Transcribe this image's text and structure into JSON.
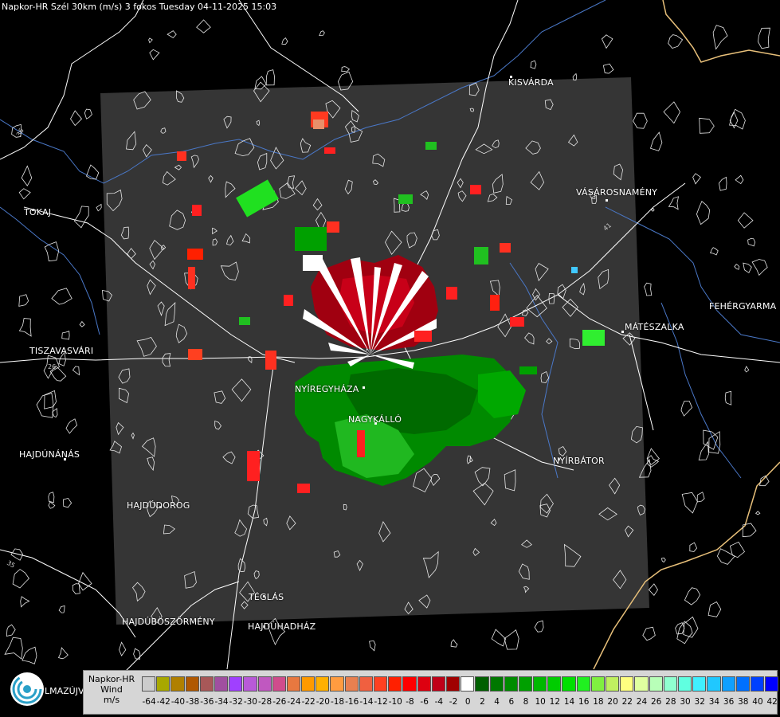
{
  "title": "Napkor-HR Szél 30km (m/s) 3 fokos Tuesday 04-11-2025 15:03",
  "cities": [
    {
      "id": "kisvarda",
      "label": "KISVÁRDA"
    },
    {
      "id": "tokaj",
      "label": "TOKAJ"
    },
    {
      "id": "vasarosnameny",
      "label": "VÁSÁROSNAMÉNY"
    },
    {
      "id": "fehergyarmat",
      "label": "FEHÉRGYARMA"
    },
    {
      "id": "mateszalka",
      "label": "MÁTÉSZALKA"
    },
    {
      "id": "tiszavasvari",
      "label": "TISZAVASVÁRI"
    },
    {
      "id": "nyiregyhaza",
      "label": "NYÍREGYHÁZA"
    },
    {
      "id": "nagykallo",
      "label": "NAGYKÁLLÓ"
    },
    {
      "id": "nyirbator",
      "label": "NYÍRBÁTOR"
    },
    {
      "id": "hajdunanas",
      "label": "HAJDÚNÁNÁS"
    },
    {
      "id": "hajdudorog",
      "label": "HAJDÚDOROG"
    },
    {
      "id": "teglas",
      "label": "TÉGLÁS"
    },
    {
      "id": "hajduboszormeny",
      "label": "HAJDÚBÖSZÖRMÉNY"
    },
    {
      "id": "hajduhadhaz",
      "label": "HAJDÚHADHÁZ"
    }
  ],
  "road_numbers": [
    "36",
    "26",
    "41",
    "35"
  ],
  "logo_text": "LMAZÚJVÁR",
  "legend": {
    "line1": "Napkor-HR",
    "line2": "Wind",
    "line3": "m/s",
    "items": [
      {
        "label": "-64",
        "color": "#cccccc"
      },
      {
        "label": "-42",
        "color": "#a8a800"
      },
      {
        "label": "-40",
        "color": "#b08000"
      },
      {
        "label": "-38",
        "color": "#b05800"
      },
      {
        "label": "-36",
        "color": "#a85858"
      },
      {
        "label": "-34",
        "color": "#a04fa0"
      },
      {
        "label": "-32",
        "color": "#a040ff"
      },
      {
        "label": "-30",
        "color": "#b85ad8"
      },
      {
        "label": "-28",
        "color": "#c058c0"
      },
      {
        "label": "-26",
        "color": "#d04c8c"
      },
      {
        "label": "-24",
        "color": "#e87840"
      },
      {
        "label": "-22",
        "color": "#ff9a00"
      },
      {
        "label": "-20",
        "color": "#ffb000"
      },
      {
        "label": "-18",
        "color": "#ff9c40"
      },
      {
        "label": "-16",
        "color": "#e88050"
      },
      {
        "label": "-14",
        "color": "#f06040"
      },
      {
        "label": "-12",
        "color": "#ff4020"
      },
      {
        "label": "-10",
        "color": "#ff2000"
      },
      {
        "label": "-8",
        "color": "#ff0000"
      },
      {
        "label": "-6",
        "color": "#dd0010"
      },
      {
        "label": "-4",
        "color": "#c00018"
      },
      {
        "label": "-2",
        "color": "#a00000"
      },
      {
        "label": "0",
        "color": "#ffffff"
      },
      {
        "label": "2",
        "color": "#006000"
      },
      {
        "label": "4",
        "color": "#007800"
      },
      {
        "label": "6",
        "color": "#008c00"
      },
      {
        "label": "8",
        "color": "#00a000"
      },
      {
        "label": "10",
        "color": "#00b800"
      },
      {
        "label": "12",
        "color": "#00cc00"
      },
      {
        "label": "14",
        "color": "#00e000"
      },
      {
        "label": "16",
        "color": "#20f020"
      },
      {
        "label": "18",
        "color": "#80f040"
      },
      {
        "label": "20",
        "color": "#c0f060"
      },
      {
        "label": "22",
        "color": "#ffff80"
      },
      {
        "label": "24",
        "color": "#e0ffa0"
      },
      {
        "label": "26",
        "color": "#b8ffb8"
      },
      {
        "label": "28",
        "color": "#90ffd0"
      },
      {
        "label": "30",
        "color": "#60ffe0"
      },
      {
        "label": "32",
        "color": "#40f0ff"
      },
      {
        "label": "34",
        "color": "#20c8ff"
      },
      {
        "label": "36",
        "color": "#10a0ff"
      },
      {
        "label": "38",
        "color": "#0070ff"
      },
      {
        "label": "40",
        "color": "#0040ff"
      },
      {
        "label": "42",
        "color": "#0000ff"
      }
    ]
  }
}
